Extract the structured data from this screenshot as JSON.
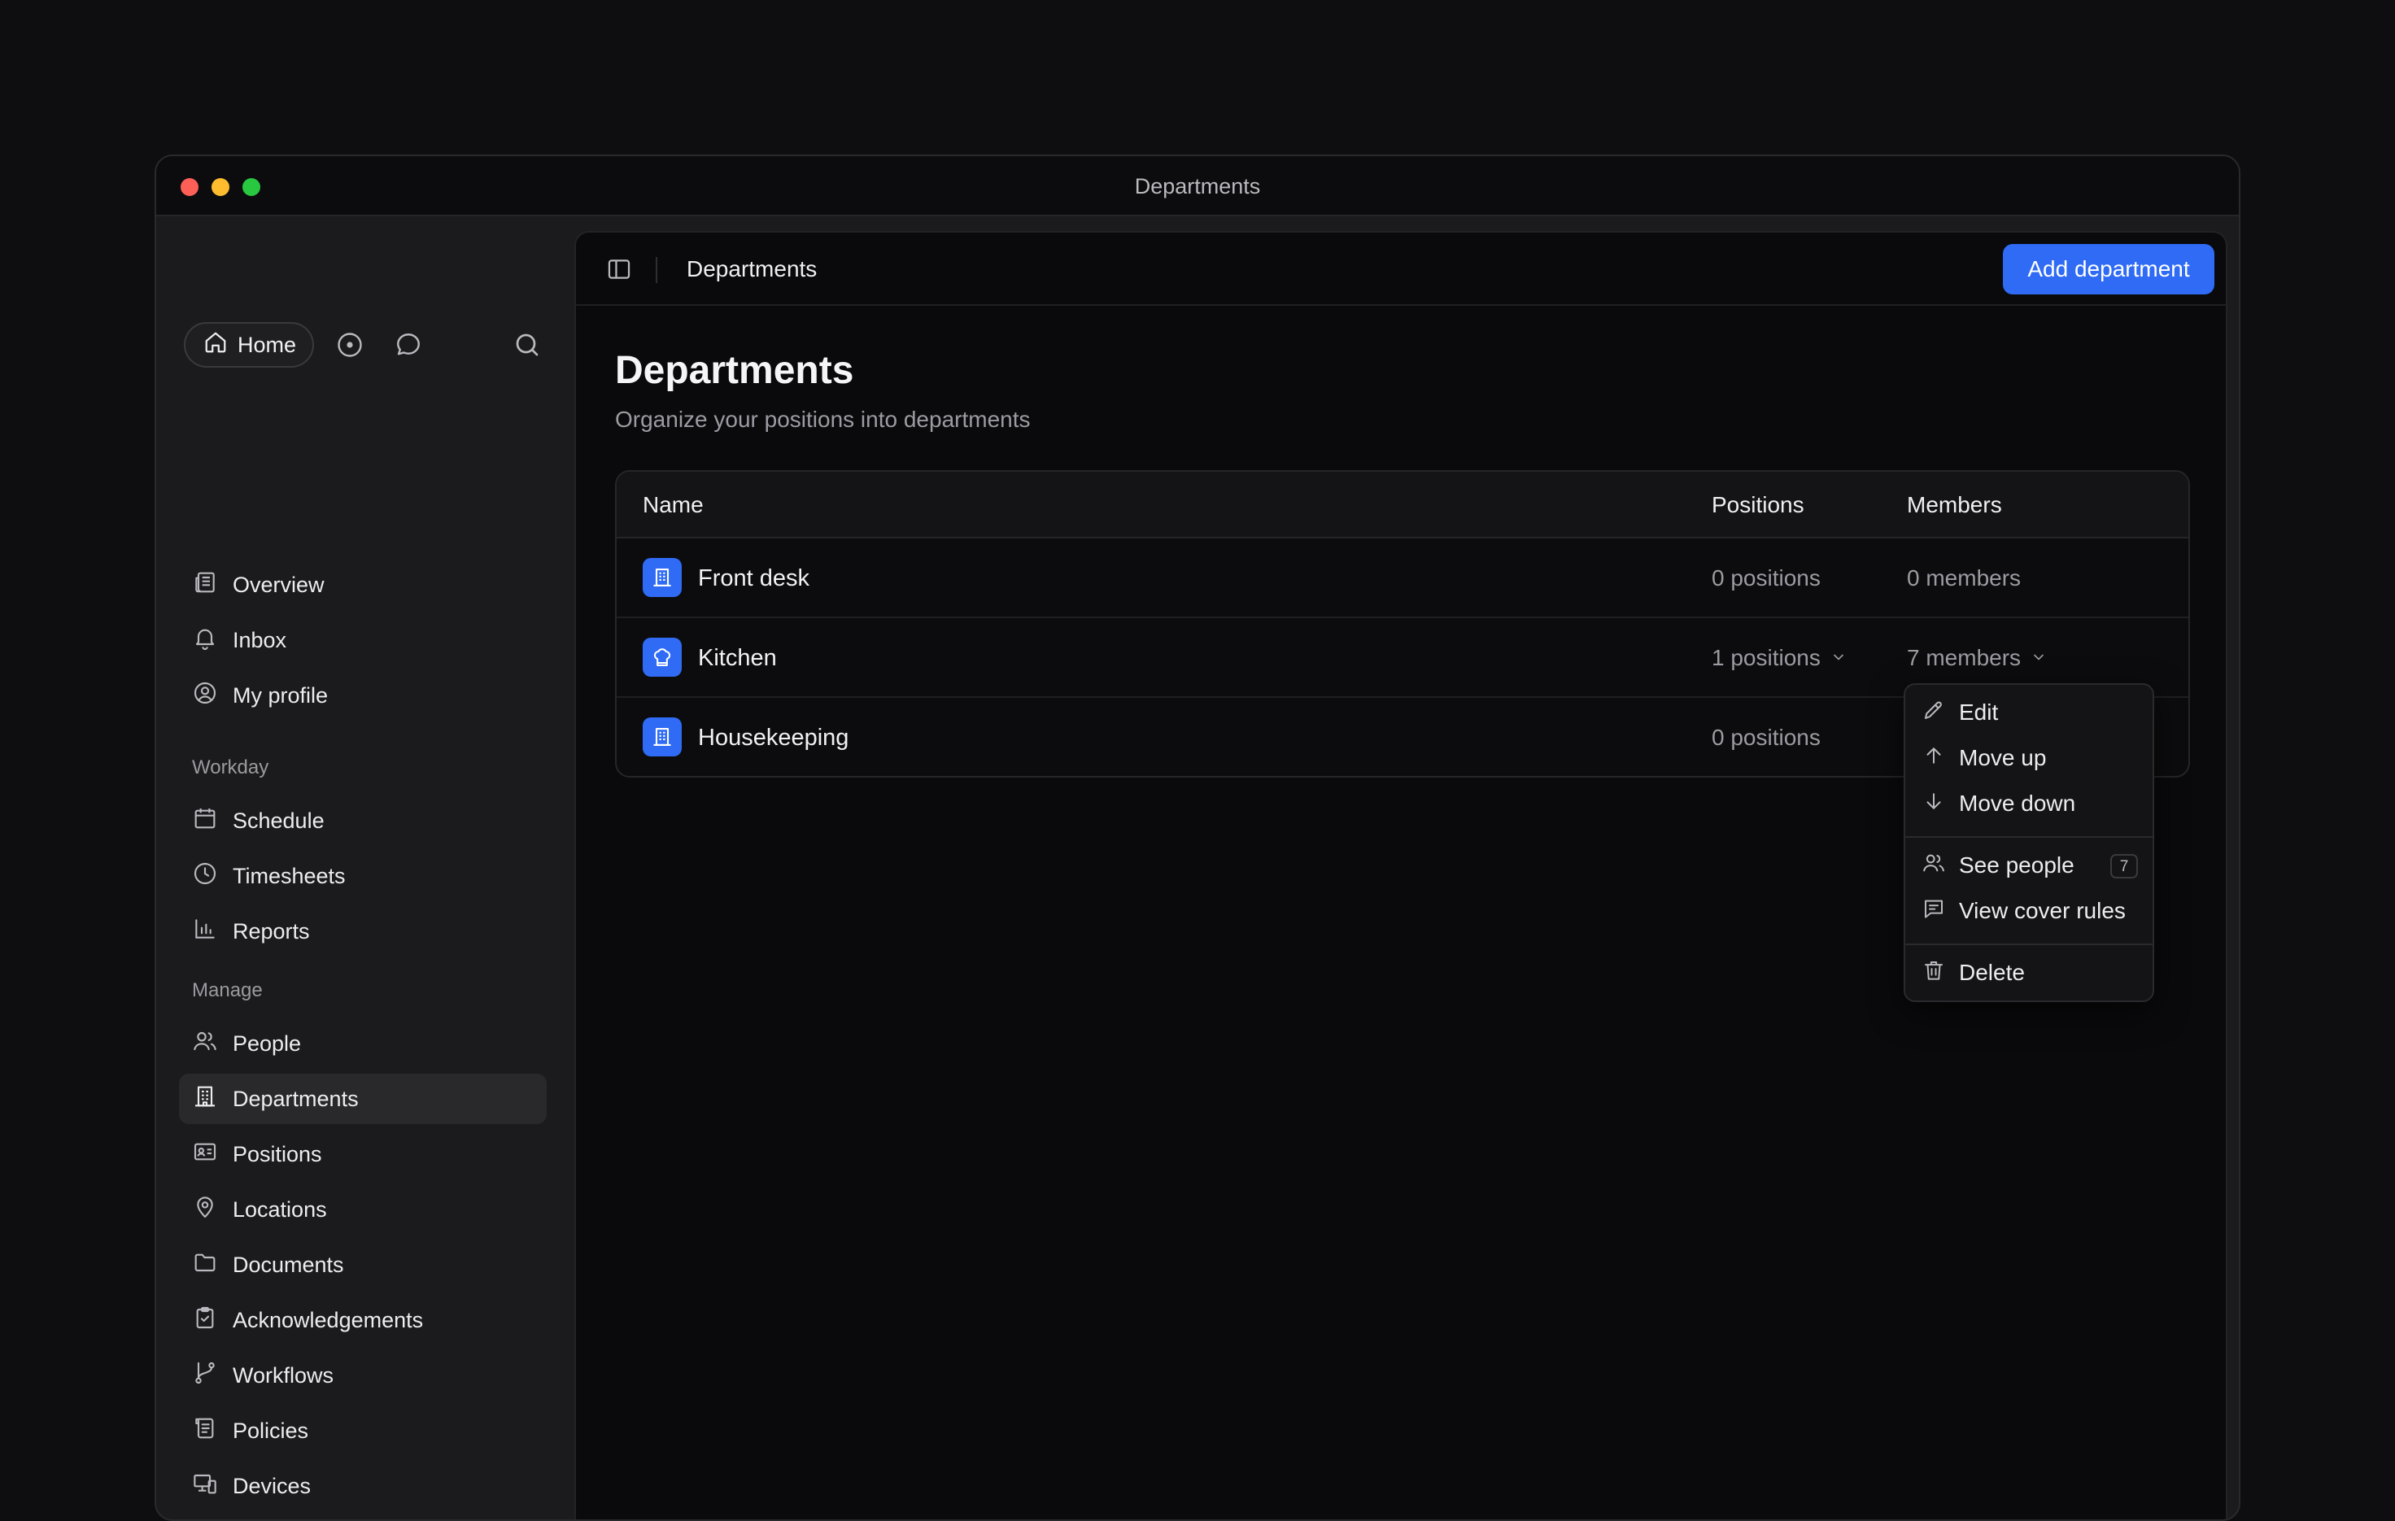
{
  "window": {
    "title": "Departments"
  },
  "sidebar": {
    "home_label": "Home",
    "primary": [
      {
        "label": "Overview",
        "icon": "newspaper-icon"
      },
      {
        "label": "Inbox",
        "icon": "bell-icon"
      },
      {
        "label": "My profile",
        "icon": "user-circle-icon"
      }
    ],
    "sections": [
      {
        "label": "Workday",
        "items": [
          {
            "label": "Schedule",
            "icon": "calendar-icon"
          },
          {
            "label": "Timesheets",
            "icon": "clock-icon"
          },
          {
            "label": "Reports",
            "icon": "bar-chart-icon"
          }
        ]
      },
      {
        "label": "Manage",
        "items": [
          {
            "label": "People",
            "icon": "users-icon"
          },
          {
            "label": "Departments",
            "icon": "building-icon",
            "active": true
          },
          {
            "label": "Positions",
            "icon": "id-card-icon"
          },
          {
            "label": "Locations",
            "icon": "map-pin-icon"
          },
          {
            "label": "Documents",
            "icon": "folder-icon"
          },
          {
            "label": "Acknowledgements",
            "icon": "clipboard-check-icon"
          },
          {
            "label": "Workflows",
            "icon": "git-branch-icon"
          },
          {
            "label": "Policies",
            "icon": "scroll-icon"
          },
          {
            "label": "Devices",
            "icon": "devices-icon"
          }
        ]
      }
    ]
  },
  "header": {
    "title": "Departments",
    "add_button_label": "Add department"
  },
  "page": {
    "title": "Departments",
    "subtitle": "Organize your positions into departments"
  },
  "table": {
    "columns": [
      "Name",
      "Positions",
      "Members"
    ],
    "rows": [
      {
        "name": "Front desk",
        "positions": "0 positions",
        "members": "0 members",
        "icon": "building-icon",
        "positions_dropdown": false,
        "members_dropdown": false
      },
      {
        "name": "Kitchen",
        "positions": "1 positions",
        "members": "7 members",
        "icon": "chef-hat-icon",
        "positions_dropdown": true,
        "members_dropdown": true
      },
      {
        "name": "Housekeeping",
        "positions": "0 positions",
        "members": "",
        "icon": "building-icon",
        "positions_dropdown": false,
        "members_dropdown": false
      }
    ]
  },
  "context_menu": {
    "items": [
      {
        "label": "Edit",
        "icon": "pencil-icon"
      },
      {
        "label": "Move up",
        "icon": "arrow-up-icon"
      },
      {
        "label": "Move down",
        "icon": "arrow-down-icon"
      },
      {
        "label": "See people",
        "icon": "users-icon",
        "badge": "7"
      },
      {
        "label": "View cover rules",
        "icon": "message-square-text-icon"
      },
      {
        "label": "Delete",
        "icon": "trash-icon"
      }
    ]
  },
  "colors": {
    "accent": "#2f6bf5",
    "background": "#0a0a0c",
    "sidebar": "#1b1b1d"
  }
}
